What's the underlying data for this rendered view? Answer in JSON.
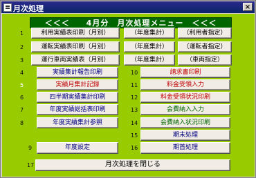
{
  "window": {
    "title": "月次処理",
    "close_glyph": "×"
  },
  "banner": "＜＜＜　　4月分　月次処理メニュー　＜＜＜",
  "rows": {
    "r1": {
      "num": "1",
      "main": "利用実績表印刷（月別）",
      "yearly": "（年度集計）",
      "extra": "（利用者指定）"
    },
    "r2": {
      "num": "2",
      "main": "運転実績表印刷（月別）",
      "yearly": "（年度集計）",
      "extra": "（運転者指定）"
    },
    "r3": {
      "num": "3",
      "main": "運行車両実績表（月別）",
      "yearly": "（年度集計）",
      "extra": "（車両指定）"
    }
  },
  "left": [
    {
      "num": "4",
      "label": "実績集計報告印刷"
    },
    {
      "num": "5",
      "label": "実績月集計記録"
    },
    {
      "num": "6",
      "label": "四半期実績集計印刷"
    },
    {
      "num": "7",
      "label": "年度実績総括表印刷"
    },
    {
      "num": "8",
      "label": "年度実績集計参照"
    },
    {
      "num": "9",
      "label": "年度設定"
    }
  ],
  "right": [
    {
      "num": "10",
      "label": "請求書印刷"
    },
    {
      "num": "11",
      "label": "料金受領入力"
    },
    {
      "num": "12",
      "label": "料金受領状況印刷"
    },
    {
      "num": "13",
      "label": "会費納入入力"
    },
    {
      "num": "14",
      "label": "会費納入状況印刷"
    },
    {
      "num": "15",
      "label": "期末処理"
    },
    {
      "num": "16",
      "label": "期首処理"
    }
  ],
  "close": {
    "num": "17",
    "label": "月次処理を閉じる"
  }
}
